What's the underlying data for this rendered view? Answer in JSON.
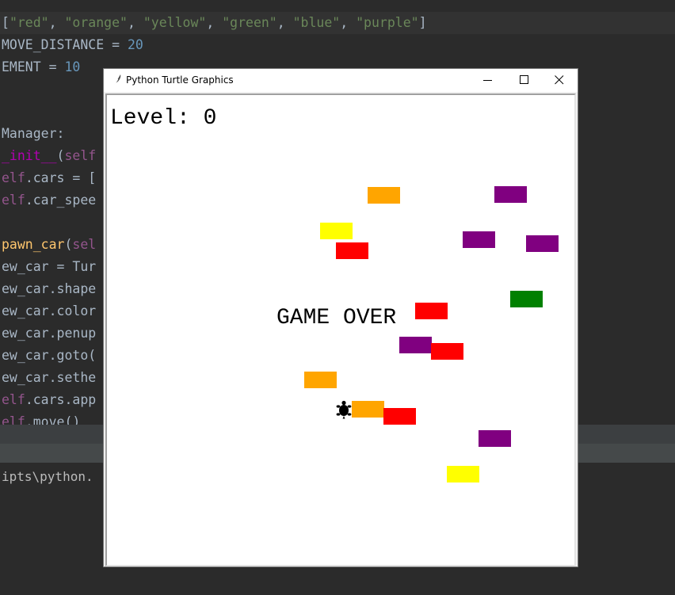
{
  "editor": {
    "lines": [
      {
        "tokens": [
          {
            "t": "[",
            "c": "tok-punc"
          },
          {
            "t": "\"red\"",
            "c": "tok-str"
          },
          {
            "t": ", ",
            "c": "tok-punc"
          },
          {
            "t": "\"orange\"",
            "c": "tok-str"
          },
          {
            "t": ", ",
            "c": "tok-punc"
          },
          {
            "t": "\"yellow\"",
            "c": "tok-str"
          },
          {
            "t": ", ",
            "c": "tok-punc"
          },
          {
            "t": "\"green\"",
            "c": "tok-str"
          },
          {
            "t": ", ",
            "c": "tok-punc"
          },
          {
            "t": "\"blue\"",
            "c": "tok-str"
          },
          {
            "t": ", ",
            "c": "tok-punc"
          },
          {
            "t": "\"purple\"",
            "c": "tok-str"
          },
          {
            "t": "]",
            "c": "tok-punc"
          }
        ]
      },
      {
        "tokens": [
          {
            "t": "MOVE_DISTANCE = ",
            "c": "tok-punc"
          },
          {
            "t": "20",
            "c": "tok-num"
          }
        ]
      },
      {
        "tokens": [
          {
            "t": "EMENT = ",
            "c": "tok-punc"
          },
          {
            "t": "10",
            "c": "tok-num"
          }
        ]
      },
      {
        "tokens": []
      },
      {
        "tokens": []
      },
      {
        "tokens": [
          {
            "t": "Manager:",
            "c": "tok-punc"
          }
        ]
      },
      {
        "tokens": [
          {
            "t": "_init__",
            "c": "tok-magic"
          },
          {
            "t": "(",
            "c": "tok-punc"
          },
          {
            "t": "self",
            "c": "tok-self"
          }
        ]
      },
      {
        "tokens": [
          {
            "t": "elf",
            "c": "tok-self"
          },
          {
            "t": ".cars = [",
            "c": "tok-punc"
          }
        ]
      },
      {
        "tokens": [
          {
            "t": "elf",
            "c": "tok-self"
          },
          {
            "t": ".car_spee",
            "c": "tok-punc"
          }
        ]
      },
      {
        "tokens": []
      },
      {
        "tokens": [
          {
            "t": "pawn_car",
            "c": "tok-fn"
          },
          {
            "t": "(",
            "c": "tok-punc"
          },
          {
            "t": "sel",
            "c": "tok-self"
          }
        ]
      },
      {
        "tokens": [
          {
            "t": "ew_car = Tur",
            "c": "tok-punc"
          }
        ]
      },
      {
        "tokens": [
          {
            "t": "ew_car.shape",
            "c": "tok-punc"
          }
        ]
      },
      {
        "tokens": [
          {
            "t": "ew_car.color",
            "c": "tok-punc"
          }
        ]
      },
      {
        "tokens": [
          {
            "t": "ew_car.penup",
            "c": "tok-punc"
          }
        ]
      },
      {
        "tokens": [
          {
            "t": "ew_car.goto(",
            "c": "tok-punc"
          }
        ]
      },
      {
        "tokens": [
          {
            "t": "ew_car.sethe",
            "c": "tok-punc"
          }
        ]
      },
      {
        "tokens": [
          {
            "t": "elf",
            "c": "tok-self"
          },
          {
            "t": ".cars.app",
            "c": "tok-punc"
          }
        ]
      },
      {
        "tokens": [
          {
            "t": "elf",
            "c": "tok-self"
          },
          {
            "t": ".move()",
            "c": "tok-punc"
          }
        ]
      }
    ]
  },
  "terminal": {
    "text": "ipts\\python."
  },
  "window": {
    "title": "Python Turtle Graphics",
    "minimize_icon": "minimize-icon",
    "maximize_icon": "maximize-icon",
    "close_icon": "close-icon"
  },
  "game": {
    "level_text": "Level: 0",
    "game_over_text": "GAME OVER",
    "turtle_icon": "turtle-icon",
    "cars": [
      {
        "color": "#ffa500",
        "name": "orange"
      },
      {
        "color": "#800080",
        "name": "purple"
      },
      {
        "color": "#ffff00",
        "name": "yellow"
      },
      {
        "color": "#ff0000",
        "name": "red"
      },
      {
        "color": "#800080",
        "name": "purple"
      },
      {
        "color": "#800080",
        "name": "purple"
      },
      {
        "color": "#008000",
        "name": "green"
      },
      {
        "color": "#ff0000",
        "name": "red"
      },
      {
        "color": "#800080",
        "name": "purple"
      },
      {
        "color": "#ff0000",
        "name": "red"
      },
      {
        "color": "#ffa500",
        "name": "orange"
      },
      {
        "color": "#ffa500",
        "name": "orange"
      },
      {
        "color": "#ff0000",
        "name": "red"
      },
      {
        "color": "#800080",
        "name": "purple"
      },
      {
        "color": "#ffff00",
        "name": "yellow"
      }
    ]
  }
}
